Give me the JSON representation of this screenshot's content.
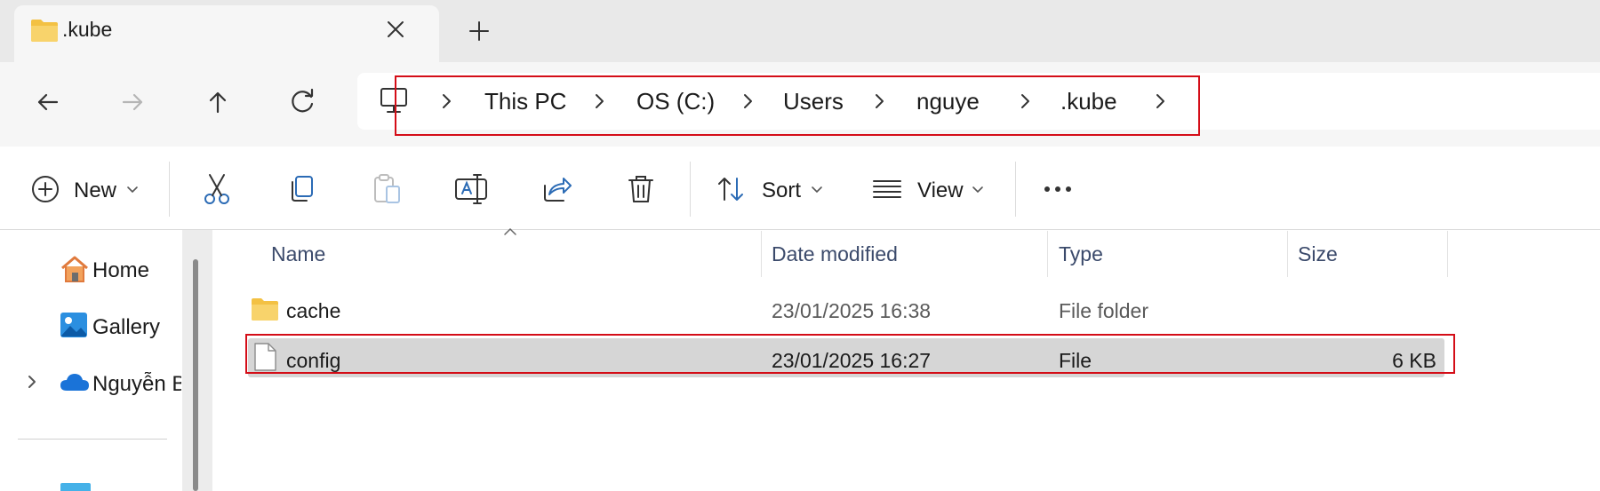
{
  "tab": {
    "title": ".kube",
    "close_icon": "close-icon",
    "new_tab_icon": "plus-icon"
  },
  "nav": {
    "back_icon": "arrow-left-icon",
    "forward_icon": "arrow-right-icon",
    "up_icon": "arrow-up-icon",
    "refresh_icon": "refresh-icon"
  },
  "breadcrumb": {
    "root_icon": "computer-icon",
    "items": [
      "This PC",
      "OS (C:)",
      "Users",
      "nguye",
      ".kube"
    ]
  },
  "toolbar": {
    "new_label": "New",
    "sort_label": "Sort",
    "view_label": "View",
    "icons": [
      "cut-icon",
      "copy-icon",
      "paste-icon",
      "rename-icon",
      "share-icon",
      "delete-icon",
      "more-icon"
    ]
  },
  "sidebar": {
    "items": [
      {
        "label": "Home",
        "icon": "home-icon"
      },
      {
        "label": "Gallery",
        "icon": "gallery-icon"
      },
      {
        "label": "Nguyễn B",
        "icon": "onedrive-cloud-icon"
      }
    ]
  },
  "file_list": {
    "columns": [
      "Name",
      "Date modified",
      "Type",
      "Size"
    ],
    "rows": [
      {
        "name": "cache",
        "date": "23/01/2025 16:38",
        "type": "File folder",
        "size": "",
        "icon": "folder-icon"
      },
      {
        "name": "config",
        "date": "23/01/2025 16:27",
        "type": "File",
        "size": "6 KB",
        "icon": "file-icon",
        "selected": true
      }
    ]
  },
  "colors": {
    "highlight_box": "#d40d17",
    "folder": "#f3c143",
    "selected_row": "#d6d6d6"
  }
}
